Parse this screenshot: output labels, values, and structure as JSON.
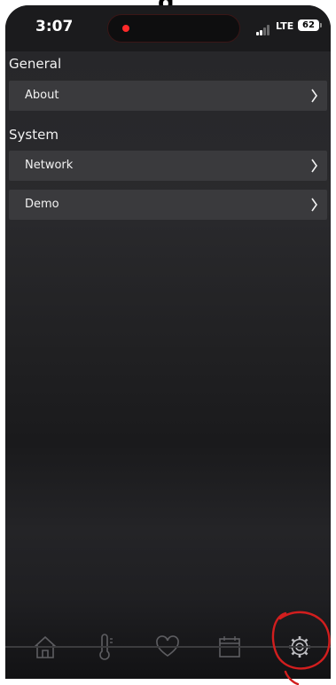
{
  "status_bar": {
    "time": "3:07",
    "network": "LTE",
    "battery": "62"
  },
  "sections": [
    {
      "header": "General",
      "items": [
        {
          "label": "About"
        }
      ]
    },
    {
      "header": "System",
      "items": [
        {
          "label": "Network"
        },
        {
          "label": "Demo"
        }
      ]
    }
  ],
  "tab_bar": {
    "tabs": [
      {
        "icon": "home-icon"
      },
      {
        "icon": "thermometer-icon"
      },
      {
        "icon": "heart-icon"
      },
      {
        "icon": "calendar-icon"
      },
      {
        "icon": "gear-icon",
        "selected": true
      }
    ]
  },
  "colors": {
    "row_background": "#3a3a3d",
    "text": "#f2f2f2",
    "annotation": "#d21e1e",
    "recording_dot": "#ff2a2a"
  }
}
